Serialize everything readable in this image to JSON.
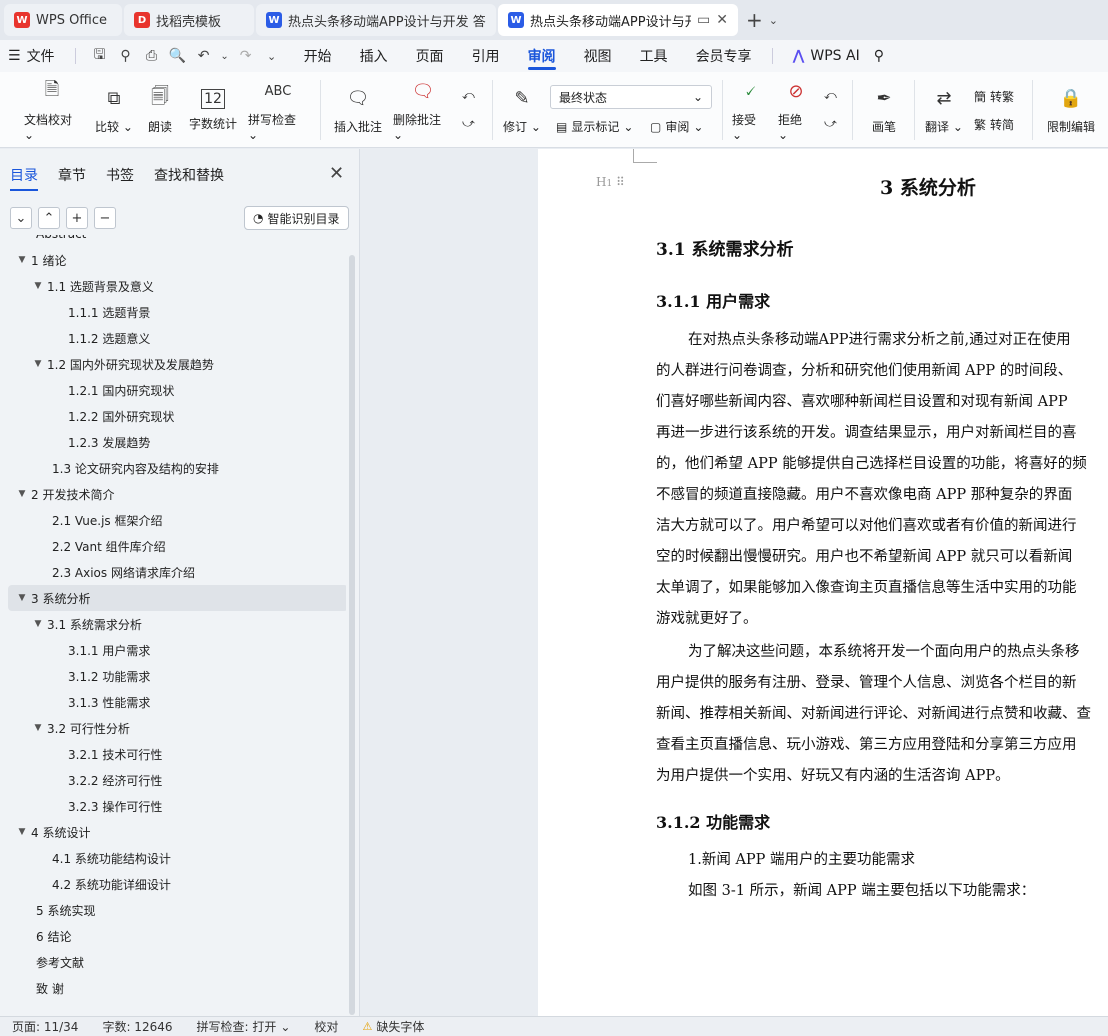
{
  "tabs": [
    {
      "label": "WPS Office",
      "logo": "W",
      "color": "#e8342d",
      "active": false
    },
    {
      "label": "找稻壳模板",
      "logo": "D",
      "color": "#e8342d",
      "active": false
    },
    {
      "label": "热点头条移动端APP设计与开发 答辩",
      "logo": "W",
      "color": "#2b5ce6",
      "active": false
    },
    {
      "label": "热点头条移动端APP设计与开发",
      "logo": "W",
      "color": "#2b5ce6",
      "active": true
    }
  ],
  "menu": {
    "file": "文件",
    "items": [
      "开始",
      "插入",
      "页面",
      "引用",
      "审阅",
      "视图",
      "工具",
      "会员专享"
    ],
    "active": "审阅",
    "ai": "WPS AI"
  },
  "ribbon": {
    "doc_check": "文档校对",
    "compare": "比较",
    "read_aloud": "朗读",
    "word_count": "字数统计",
    "spell_check": "拼写检查",
    "insert_comment": "插入批注",
    "delete_comment": "删除批注",
    "revise": "修订",
    "status_select": "最终状态",
    "show_markup": "显示标记",
    "review": "审阅",
    "accept": "接受",
    "reject": "拒绝",
    "pen": "画笔",
    "translate": "翻译",
    "to_traditional": "转繁",
    "to_simplified": "转简",
    "restrict_edit": "限制编辑"
  },
  "panel": {
    "tabs": [
      "目录",
      "章节",
      "书签",
      "查找和替换"
    ],
    "active_tab": "目录",
    "smart_toc": "智能识别目录"
  },
  "toc": [
    {
      "text": "Abstract",
      "level": 0,
      "arrow": false
    },
    {
      "text": "1  绪论",
      "level": 0,
      "arrow": true
    },
    {
      "text": "1.1  选题背景及意义",
      "level": 1,
      "arrow": true
    },
    {
      "text": "1.1.1  选题背景",
      "level": 2,
      "arrow": false
    },
    {
      "text": "1.1.2  选题意义",
      "level": 2,
      "arrow": false
    },
    {
      "text": "1.2  国内外研究现状及发展趋势",
      "level": 1,
      "arrow": true
    },
    {
      "text": "1.2.1  国内研究现状",
      "level": 2,
      "arrow": false
    },
    {
      "text": "1.2.2  国外研究现状",
      "level": 2,
      "arrow": false
    },
    {
      "text": "1.2.3  发展趋势",
      "level": 2,
      "arrow": false
    },
    {
      "text": "1.3 论文研究内容及结构的安排",
      "level": 1,
      "arrow": false
    },
    {
      "text": "2  开发技术简介",
      "level": 0,
      "arrow": true
    },
    {
      "text": "2.1 Vue.js 框架介绍",
      "level": 1,
      "arrow": false
    },
    {
      "text": "2.2 Vant 组件库介绍",
      "level": 1,
      "arrow": false
    },
    {
      "text": "2.3 Axios 网络请求库介绍",
      "level": 1,
      "arrow": false
    },
    {
      "text": "3  系统分析",
      "level": 0,
      "arrow": true,
      "selected": true
    },
    {
      "text": "3.1  系统需求分析",
      "level": 1,
      "arrow": true
    },
    {
      "text": "3.1.1  用户需求",
      "level": 2,
      "arrow": false
    },
    {
      "text": "3.1.2  功能需求",
      "level": 2,
      "arrow": false
    },
    {
      "text": "3.1.3  性能需求",
      "level": 2,
      "arrow": false
    },
    {
      "text": "3.2  可行性分析",
      "level": 1,
      "arrow": true
    },
    {
      "text": "3.2.1  技术可行性",
      "level": 2,
      "arrow": false
    },
    {
      "text": "3.2.2  经济可行性",
      "level": 2,
      "arrow": false
    },
    {
      "text": "3.2.3  操作可行性",
      "level": 2,
      "arrow": false
    },
    {
      "text": "4  系统设计",
      "level": 0,
      "arrow": true
    },
    {
      "text": "4.1  系统功能结构设计",
      "level": 1,
      "arrow": false
    },
    {
      "text": "4.2  系统功能详细设计",
      "level": 1,
      "arrow": false
    },
    {
      "text": "5  系统实现",
      "level": 0,
      "arrow": false
    },
    {
      "text": "6  结论",
      "level": 0,
      "arrow": false
    },
    {
      "text": "参考文献",
      "level": 0,
      "arrow": false
    },
    {
      "text": "致    谢",
      "level": 0,
      "arrow": false
    }
  ],
  "doc": {
    "chapter": "3  系统分析",
    "section": "3.1  系统需求分析",
    "sub1": "3.1.1  用户需求",
    "para1": [
      "在对热点头条移动端APP进行需求分析之前,通过对正在使用",
      "的人群进行问卷调查，分析和研究他们使用新闻 APP 的时间段、",
      "们喜好哪些新闻内容、喜欢哪种新闻栏目设置和对现有新闻 APP",
      "再进一步进行该系统的开发。调查结果显示，用户对新闻栏目的喜",
      "的，他们希望 APP 能够提供自己选择栏目设置的功能，将喜好的频",
      "不感冒的频道直接隐藏。用户不喜欢像电商 APP 那种复杂的界面",
      "洁大方就可以了。用户希望可以对他们喜欢或者有价值的新闻进行",
      "空的时候翻出慢慢研究。用户也不希望新闻 APP 就只可以看新闻",
      "太单调了，如果能够加入像查询主页直播信息等生活中实用的功能",
      "游戏就更好了。"
    ],
    "para2": [
      "为了解决这些问题，本系统将开发一个面向用户的热点头条移",
      "用户提供的服务有注册、登录、管理个人信息、浏览各个栏目的新",
      "新闻、推荐相关新闻、对新闻进行评论、对新闻进行点赞和收藏、查",
      "查看主页直播信息、玩小游戏、第三方应用登陆和分享第三方应用",
      "为用户提供一个实用、好玩又有内涵的生活咨询 APP。"
    ],
    "sub2": "3.1.2  功能需求",
    "para3": [
      "1.新闻 APP 端用户的主要功能需求",
      "如图 3-1 所示，新闻 APP 端主要包括以下功能需求："
    ]
  },
  "status": {
    "page": "页面: 11/34",
    "words": "字数: 12646",
    "spell": "拼写检查: 打开",
    "proof": "校对",
    "missing_font": "缺失字体"
  }
}
